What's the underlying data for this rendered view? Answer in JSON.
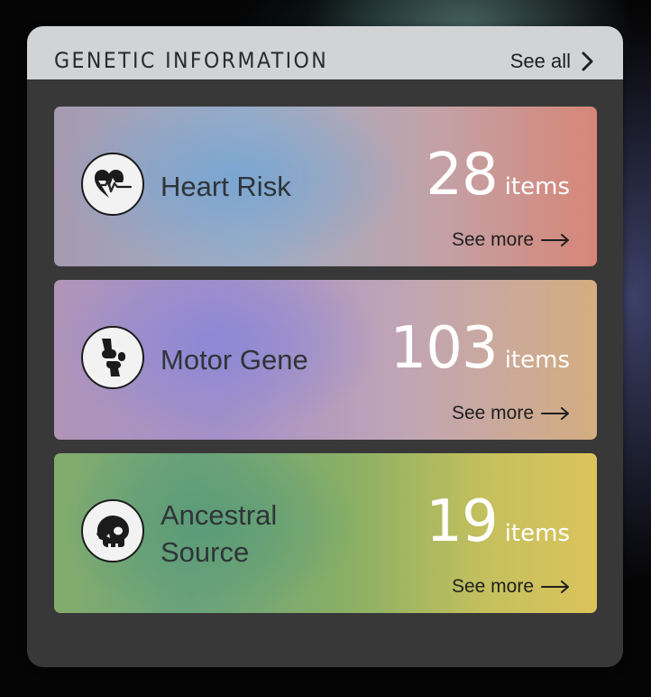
{
  "widget": {
    "title": "GENETIC INFORMATION",
    "see_all": "See all",
    "see_all_icon": "chevron-right-icon"
  },
  "cards": [
    {
      "label": "Heart Risk",
      "count": "28",
      "unit": "items",
      "link": "See more",
      "icon": "heart-pulse-icon",
      "accent": "#d78677"
    },
    {
      "label": "Motor Gene",
      "count": "103",
      "unit": "items",
      "link": "See more",
      "icon": "knee-joint-icon",
      "accent": "#a590c8"
    },
    {
      "label": "Ancestral Source",
      "count": "19",
      "unit": "items",
      "link": "See more",
      "icon": "skull-icon",
      "accent": "#dcc35c"
    }
  ]
}
